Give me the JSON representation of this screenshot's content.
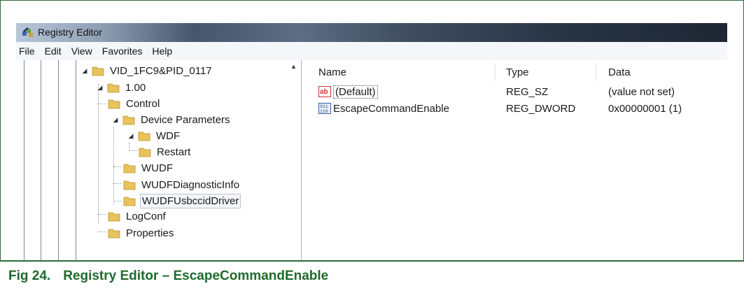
{
  "window": {
    "title": "Registry Editor",
    "icon": "regedit-icon"
  },
  "menu": [
    "File",
    "Edit",
    "View",
    "Favorites",
    "Help"
  ],
  "tree": {
    "nodes": [
      {
        "label": "VID_1FC9&PID_0117",
        "expanded": true
      },
      {
        "label": "1.00",
        "expanded": true
      },
      {
        "label": "Control",
        "expanded": false
      },
      {
        "label": "Device Parameters",
        "expanded": true
      },
      {
        "label": "WDF",
        "expanded": true
      },
      {
        "label": "Restart",
        "expanded": false
      },
      {
        "label": "WUDF",
        "expanded": false
      },
      {
        "label": "WUDFDiagnosticInfo",
        "expanded": false
      },
      {
        "label": "WUDFUsbccidDriver",
        "expanded": false,
        "selected": true
      },
      {
        "label": "LogConf",
        "expanded": false
      },
      {
        "label": "Properties",
        "expanded": false
      }
    ]
  },
  "list": {
    "columns": [
      "Name",
      "Type",
      "Data"
    ],
    "rows": [
      {
        "icon": "string-value-icon",
        "name": "(Default)",
        "type": "REG_SZ",
        "data": "(value not set)"
      },
      {
        "icon": "binary-value-icon",
        "name": "EscapeCommandEnable",
        "type": "REG_DWORD",
        "data": "0x00000001 (1)"
      }
    ]
  },
  "caption": {
    "number": "Fig 24.",
    "text": "Registry Editor – EscapeCommandEnable"
  },
  "colors": {
    "frame": "#2e6b3a",
    "caption": "#1e6b2b",
    "folder": "#e8c25a"
  }
}
